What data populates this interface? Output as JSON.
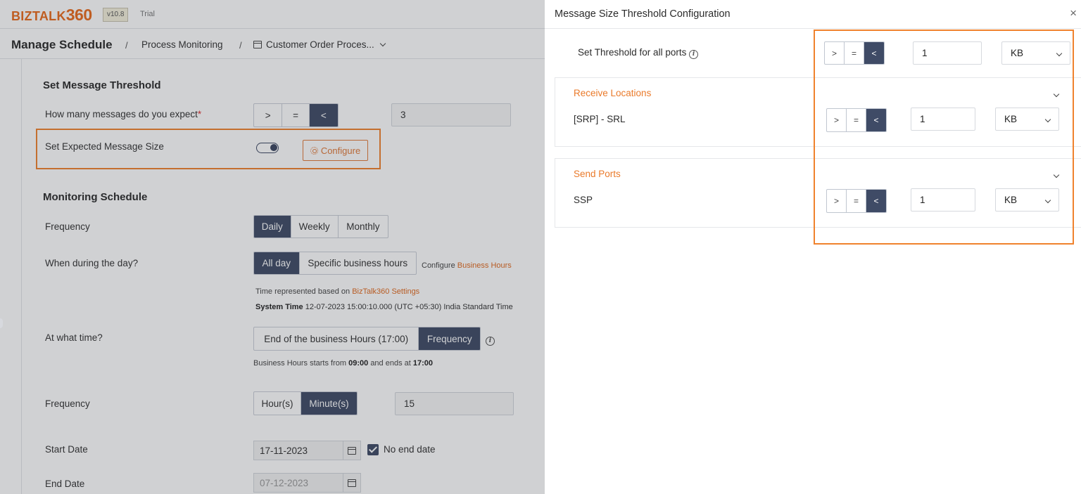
{
  "app": {
    "logo_text": "BIZTALK",
    "logo_num": "360",
    "version": "v10.8",
    "trial": "Trial"
  },
  "breadcrumb": {
    "title": "Manage Schedule",
    "sep": "/",
    "item1": "Process Monitoring",
    "item2": "Customer Order Proces..."
  },
  "threshold": {
    "section_title": "Set Message Threshold",
    "expect_label": "How many messages do you expect",
    "required_mark": "*",
    "ops": [
      ">",
      "=",
      "<"
    ],
    "count_value": "3",
    "size_label": "Set Expected Message Size",
    "configure_label": "Configure"
  },
  "schedule": {
    "section_title": "Monitoring Schedule",
    "frequency_label": "Frequency",
    "frequency_options": [
      "Daily",
      "Weekly",
      "Monthly"
    ],
    "when_label": "When during the day?",
    "when_options": [
      "All day",
      "Specific business hours"
    ],
    "configure_text": "Configure",
    "business_hours_link": "Business Hours",
    "time_note_prefix": "Time represented based on",
    "time_note_link": "BizTalk360 Settings",
    "system_time_label": "System Time",
    "system_time_value": "12-07-2023 15:00:10.000 (UTC +05:30) India Standard Time",
    "at_what_time_label": "At what time?",
    "at_time_options": [
      "End of the business Hours (17:00)",
      "Frequency"
    ],
    "bh_note_prefix": "Business Hours starts from",
    "bh_start": "09:00",
    "bh_mid": "and ends at",
    "bh_end": "17:00",
    "frequency2_label": "Frequency",
    "freq_unit_options": [
      "Hour(s)",
      "Minute(s)"
    ],
    "freq_value": "15",
    "start_label": "Start Date",
    "start_value": "17-11-2023",
    "no_end_label": "No end date",
    "end_label": "End Date",
    "end_value": "07-12-2023"
  },
  "panel": {
    "title": "Message Size Threshold Configuration",
    "close": "×",
    "all_ports_label": "Set Threshold for all ports",
    "all_ports_value": "1",
    "all_ports_unit": "KB",
    "receive_title": "Receive Locations",
    "receive_item": "[SRP] - SRL",
    "receive_value": "1",
    "receive_unit": "KB",
    "send_title": "Send Ports",
    "send_item": "SSP",
    "send_value": "1",
    "send_unit": "KB",
    "ops": [
      ">",
      "=",
      "<"
    ]
  }
}
